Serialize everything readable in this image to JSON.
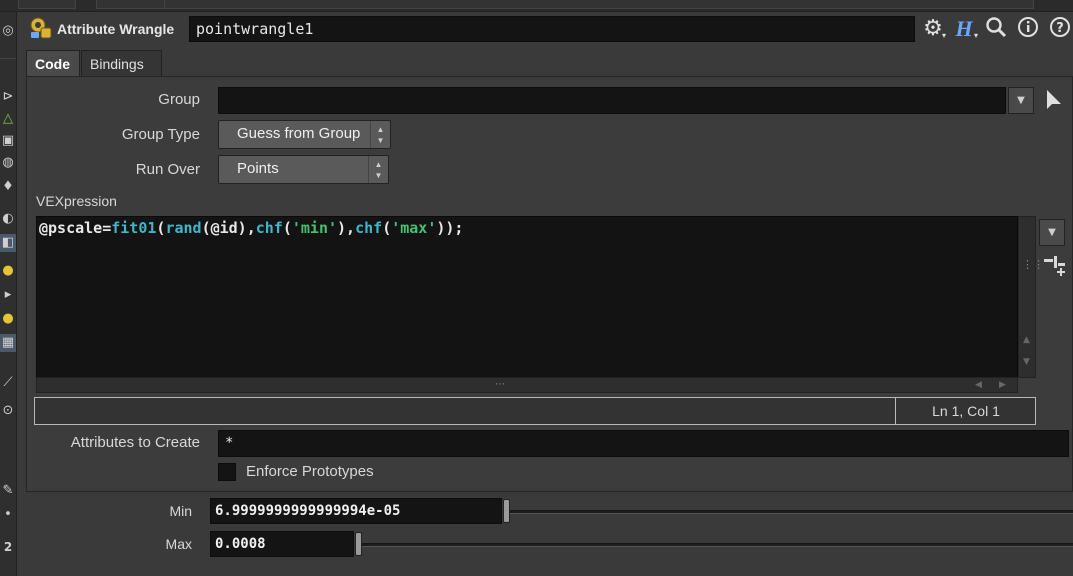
{
  "header": {
    "node_type": "Attribute Wrangle",
    "node_name": "pointwrangle1",
    "help_icon_letter": "H",
    "help_icon_color": "#6aa7ff"
  },
  "tabs": [
    {
      "label": "Code",
      "active": true
    },
    {
      "label": "Bindings",
      "active": false
    }
  ],
  "params": {
    "group_label": "Group",
    "group_value": "",
    "group_type_label": "Group Type",
    "group_type_value": "Guess from Group",
    "run_over_label": "Run Over",
    "run_over_value": "Points",
    "vexpression_label": "VEXpression",
    "code": {
      "t1": "@pscale",
      "t2": "=",
      "t3": "fit01",
      "t4": "(",
      "t5": "rand",
      "t6": "(@id),",
      "t7": "chf",
      "t8": "(",
      "t9": "'min'",
      "t10": "),",
      "t11": "chf",
      "t12": "(",
      "t13": "'max'",
      "t14": "));"
    },
    "status_position": "Ln 1, Col 1",
    "attributes_label": "Attributes to Create",
    "attributes_value": "*",
    "enforce_label": "Enforce Prototypes",
    "enforce_checked": false
  },
  "sliders": [
    {
      "label": "Min",
      "value": "6.9999999999999994e-05",
      "fraction": 0.0
    },
    {
      "label": "Max",
      "value": "0.0008",
      "fraction": 0.0
    }
  ],
  "colors": {
    "code_function": "#3fb6c9",
    "code_string": "#44c26f",
    "wrangle_icon": "#d9b23a"
  }
}
